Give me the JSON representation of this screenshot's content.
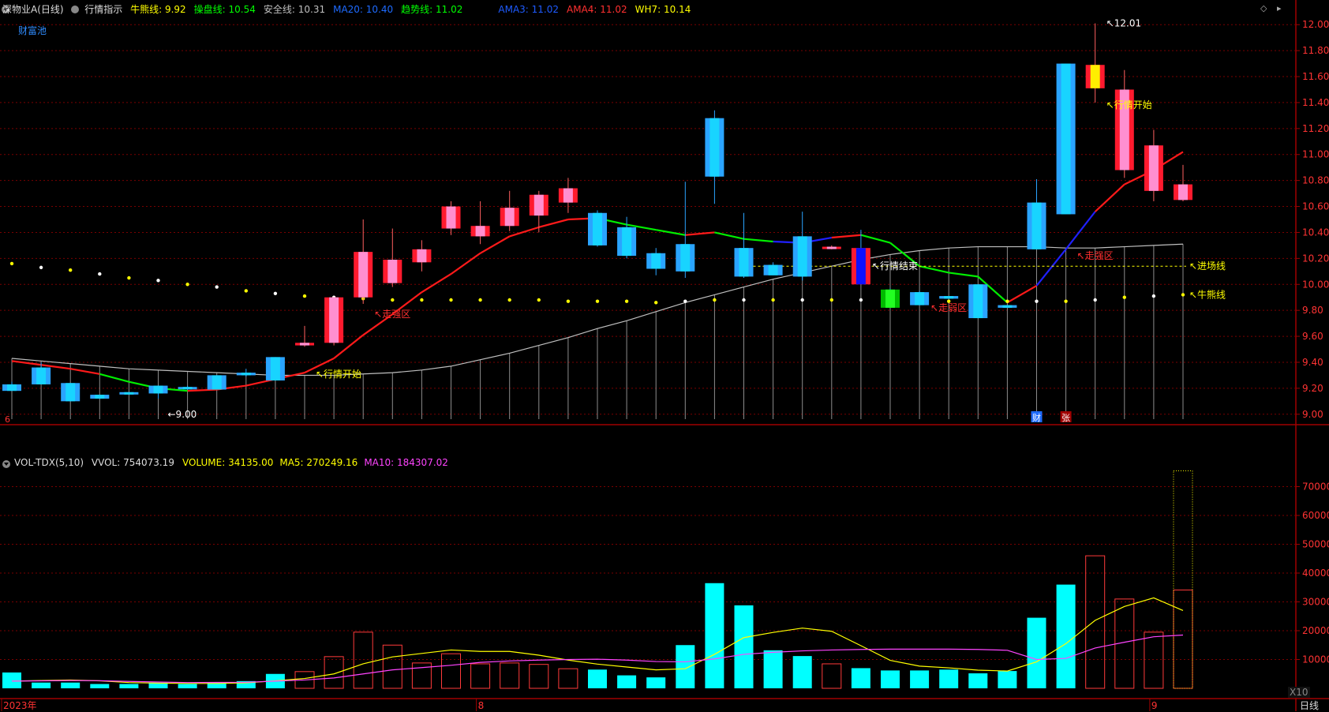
{
  "header": {
    "title": "深物业A(日线)",
    "indicator_name": "行情指示",
    "items": [
      {
        "label": "牛熊线:",
        "value": "9.92",
        "color": "#ffff00"
      },
      {
        "label": "操盘线:",
        "value": "10.54",
        "color": "#00ff00"
      },
      {
        "label": "安全线:",
        "value": "10.31",
        "color": "#bfbfbf"
      },
      {
        "label": "MA20:",
        "value": "10.40",
        "color": "#1e6bff"
      },
      {
        "label": "趋势线:",
        "value": "11.02",
        "color": "#00ff00"
      },
      {
        "label": "AMA3:",
        "value": "11.02",
        "color": "#1e5bff"
      },
      {
        "label": "AMA4:",
        "value": "11.02",
        "color": "#ff3030"
      },
      {
        "label": "WH7:",
        "value": "10.14",
        "color": "#ffff00"
      }
    ],
    "pool_label": "财富池"
  },
  "vol_header": {
    "name": "VOL-TDX(5,10)",
    "items": [
      {
        "label": "VVOL:",
        "value": "754073.19",
        "color": "#dddddd"
      },
      {
        "label": "VOLUME:",
        "value": "34135.00",
        "color": "#ffff00"
      },
      {
        "label": "MA5:",
        "value": "270249.16",
        "color": "#ffff00"
      },
      {
        "label": "MA10:",
        "value": "184307.02",
        "color": "#ff44ff"
      }
    ]
  },
  "footer": {
    "period_label": "日线",
    "scale_label": "X10",
    "date_labels": [
      {
        "index": 0,
        "text": "2023年"
      },
      {
        "index": 16,
        "text": "8"
      },
      {
        "index": 39,
        "text": "9"
      }
    ]
  },
  "colors": {
    "up": "#ff1a2e",
    "up_inner": "#ff8fd0",
    "down": "#2aa4ff",
    "down_inner": "#18d4ff",
    "grid": "#7a0000",
    "cyan": "#00ffff",
    "yellow": "#ffff00",
    "magenta": "#ff44ff"
  },
  "chart_data": [
    {
      "type": "candlestick",
      "title": "深物业A(日线)",
      "ylim": [
        8.95,
        12.05
      ],
      "yticks": [
        9.0,
        9.2,
        9.4,
        9.6,
        9.8,
        10.0,
        10.2,
        10.4,
        10.6,
        10.8,
        11.0,
        11.2,
        11.4,
        11.6,
        11.8,
        12.0
      ],
      "candles": [
        {
          "o": 9.23,
          "h": 9.25,
          "l": 9.18,
          "c": 9.18,
          "ma": 9.43,
          "trend": 9.41
        },
        {
          "o": 9.36,
          "h": 9.4,
          "l": 9.23,
          "c": 9.23,
          "ma": 9.41,
          "trend": 9.38
        },
        {
          "o": 9.24,
          "h": 9.24,
          "l": 9.1,
          "c": 9.1,
          "ma": 9.39,
          "trend": 9.35
        },
        {
          "o": 9.15,
          "h": 9.15,
          "l": 9.12,
          "c": 9.12,
          "ma": 9.37,
          "trend": 9.31
        },
        {
          "o": 9.17,
          "h": 9.17,
          "l": 9.15,
          "c": 9.16,
          "ma": 9.35,
          "trend": 9.25
        },
        {
          "o": 9.22,
          "h": 9.22,
          "l": 9.12,
          "c": 9.16,
          "ma": 9.34,
          "trend": 9.2
        },
        {
          "o": 9.21,
          "h": 9.22,
          "l": 9.19,
          "c": 9.2,
          "ma": 9.33,
          "trend": 9.18
        },
        {
          "o": 9.3,
          "h": 9.3,
          "l": 9.19,
          "c": 9.19,
          "ma": 9.32,
          "trend": 9.19
        },
        {
          "o": 9.32,
          "h": 9.35,
          "l": 9.29,
          "c": 9.3,
          "ma": 9.31,
          "trend": 9.22
        },
        {
          "o": 9.44,
          "h": 9.44,
          "l": 9.26,
          "c": 9.26,
          "ma": 9.3,
          "trend": 9.27
        },
        {
          "o": 9.53,
          "h": 9.68,
          "l": 9.52,
          "c": 9.55,
          "ma": 9.3,
          "trend": 9.32
        },
        {
          "o": 9.55,
          "h": 9.9,
          "l": 9.53,
          "c": 9.9,
          "ma": 9.3,
          "trend": 9.43
        },
        {
          "o": 9.9,
          "h": 10.5,
          "l": 9.85,
          "c": 10.25,
          "ma": 9.31,
          "trend": 9.61
        },
        {
          "o": 10.01,
          "h": 10.43,
          "l": 9.98,
          "c": 10.19,
          "ma": 9.32,
          "trend": 9.77
        },
        {
          "o": 10.17,
          "h": 10.34,
          "l": 10.1,
          "c": 10.27,
          "ma": 9.34,
          "trend": 9.94
        },
        {
          "o": 10.43,
          "h": 10.64,
          "l": 10.38,
          "c": 10.6,
          "ma": 9.37,
          "trend": 10.08
        },
        {
          "o": 10.37,
          "h": 10.64,
          "l": 10.31,
          "c": 10.45,
          "ma": 9.42,
          "trend": 10.24
        },
        {
          "o": 10.45,
          "h": 10.72,
          "l": 10.41,
          "c": 10.59,
          "ma": 9.47,
          "trend": 10.37
        },
        {
          "o": 10.53,
          "h": 10.72,
          "l": 10.4,
          "c": 10.69,
          "ma": 9.53,
          "trend": 10.44
        },
        {
          "o": 10.63,
          "h": 10.82,
          "l": 10.55,
          "c": 10.74,
          "ma": 9.59,
          "trend": 10.5
        },
        {
          "o": 10.55,
          "h": 10.57,
          "l": 10.29,
          "c": 10.3,
          "ma": 9.66,
          "trend": 10.51
        },
        {
          "o": 10.44,
          "h": 10.52,
          "l": 10.2,
          "c": 10.22,
          "ma": 9.72,
          "trend": 10.46
        },
        {
          "o": 10.24,
          "h": 10.28,
          "l": 10.07,
          "c": 10.12,
          "ma": 9.79,
          "trend": 10.42
        },
        {
          "o": 10.31,
          "h": 10.79,
          "l": 10.05,
          "c": 10.1,
          "ma": 9.86,
          "trend": 10.38
        },
        {
          "o": 11.28,
          "h": 11.34,
          "l": 10.62,
          "c": 10.83,
          "ma": 9.92,
          "trend": 10.4
        },
        {
          "o": 10.28,
          "h": 10.55,
          "l": 10.05,
          "c": 10.06,
          "ma": 9.98,
          "trend": 10.35
        },
        {
          "o": 10.15,
          "h": 10.17,
          "l": 10.07,
          "c": 10.07,
          "ma": 10.04,
          "trend": 10.33
        },
        {
          "o": 10.37,
          "h": 10.56,
          "l": 10.03,
          "c": 10.06,
          "ma": 10.09,
          "trend": 10.32
        },
        {
          "o": 10.28,
          "h": 10.3,
          "l": 10.27,
          "c": 10.29,
          "ma": 10.14,
          "trend": 10.36
        },
        {
          "o": 10.28,
          "h": 10.42,
          "l": 10.0,
          "c": 10.0,
          "ma": 10.19,
          "trend": 10.38
        },
        {
          "o": 9.96,
          "h": 9.97,
          "l": 9.83,
          "c": 9.82,
          "ma": 10.23,
          "trend": 10.32
        },
        {
          "o": 9.94,
          "h": 9.95,
          "l": 9.84,
          "c": 9.84,
          "ma": 10.26,
          "trend": 10.14
        },
        {
          "o": 9.91,
          "h": 9.91,
          "l": 9.89,
          "c": 9.89,
          "ma": 10.28,
          "trend": 10.09
        },
        {
          "o": 10.0,
          "h": 10.0,
          "l": 9.74,
          "c": 9.74,
          "ma": 10.29,
          "trend": 10.06
        },
        {
          "o": 9.84,
          "h": 9.84,
          "l": 9.82,
          "c": 9.82,
          "ma": 10.29,
          "trend": 9.86
        },
        {
          "o": 10.63,
          "h": 10.81,
          "l": 10.27,
          "c": 10.27,
          "ma": 10.29,
          "trend": 9.99
        },
        {
          "o": 11.7,
          "h": 11.7,
          "l": 10.54,
          "c": 10.54,
          "ma": 10.28,
          "trend": 10.27
        },
        {
          "o": 11.51,
          "h": 12.01,
          "l": 11.4,
          "c": 11.69,
          "ma": 10.28,
          "trend": 10.56
        },
        {
          "o": 10.88,
          "h": 11.65,
          "l": 10.82,
          "c": 11.5,
          "ma": 10.29,
          "trend": 10.77
        },
        {
          "o": 10.72,
          "h": 11.19,
          "l": 10.64,
          "c": 11.07,
          "ma": 10.3,
          "trend": 10.88
        },
        {
          "o": 10.65,
          "h": 10.92,
          "l": 10.64,
          "c": 10.77,
          "ma": 10.31,
          "trend": 11.02
        }
      ],
      "bull_bear_dots": [
        10.16,
        10.13,
        10.11,
        10.08,
        10.05,
        10.03,
        10.0,
        9.98,
        9.95,
        9.93,
        9.91,
        9.9,
        9.89,
        9.88,
        9.88,
        9.88,
        9.88,
        9.88,
        9.88,
        9.87,
        9.87,
        9.87,
        9.86,
        9.87,
        9.88,
        9.88,
        9.88,
        9.88,
        9.88,
        9.88,
        9.88,
        9.88,
        9.87,
        9.87,
        9.87,
        9.87,
        9.87,
        9.88,
        9.9,
        9.91,
        9.92
      ],
      "entry_line": {
        "value": 10.14,
        "label": "进场线"
      },
      "bull_bear_label": "牛熊线",
      "annotations": [
        {
          "index": 5,
          "price": 9.0,
          "text": "←9.00",
          "color": "#ffffff"
        },
        {
          "index": 37,
          "price": 12.01,
          "text": "12.01",
          "color": "#ffffff"
        },
        {
          "index": 10,
          "price": 9.31,
          "text": "行情开始",
          "color": "#ffff00"
        },
        {
          "index": 12,
          "price": 9.77,
          "text": "走强区",
          "color": "#ff3030"
        },
        {
          "index": 29,
          "price": 10.14,
          "text": "行情结束",
          "color": "#ffffff"
        },
        {
          "index": 31,
          "price": 9.82,
          "text": "走弱区",
          "color": "#ff3030"
        },
        {
          "index": 36,
          "price": 10.22,
          "text": "走强区",
          "color": "#ff3030"
        },
        {
          "index": 37,
          "price": 11.38,
          "text": "行情开始",
          "color": "#ffff00"
        }
      ],
      "markers": [
        {
          "index": 35,
          "text": "财",
          "bg": "#1e6bff",
          "fg": "#ffffff"
        },
        {
          "index": 36,
          "text": "张",
          "bg": "#a00000",
          "fg": "#ffffff"
        }
      ],
      "bottom_marker": "6"
    },
    {
      "type": "bar",
      "title": "VOL-TDX(5,10)",
      "ylim": [
        0,
        80000
      ],
      "yticks": [
        10000,
        20000,
        30000,
        40000,
        50000,
        60000,
        70000
      ],
      "volumes": [
        5500,
        2000,
        2000,
        1500,
        1500,
        2000,
        1500,
        2000,
        2500,
        5000,
        5800,
        11000,
        19500,
        15000,
        8800,
        12000,
        8500,
        8800,
        8300,
        6800,
        6500,
        4500,
        3800,
        15000,
        36500,
        28800,
        13200,
        11200,
        8500,
        7000,
        6200,
        6200,
        6500,
        5200,
        6000,
        24500,
        36000,
        46000,
        31000,
        19500,
        34135
      ],
      "ma5": [
        2500,
        2700,
        2900,
        2600,
        2000,
        1800,
        1700,
        1700,
        1900,
        2600,
        3400,
        5000,
        8500,
        10900,
        12100,
        13300,
        12800,
        12800,
        11500,
        9800,
        8400,
        7400,
        6400,
        6800,
        11800,
        17600,
        19400,
        20900,
        19800,
        14800,
        9700,
        7700,
        7100,
        6300,
        6000,
        9200,
        15500,
        23600,
        28400,
        31400,
        27000
      ],
      "ma10": [
        2500,
        2600,
        2700,
        2650,
        2400,
        2200,
        2000,
        2050,
        2100,
        2500,
        2900,
        3600,
        5000,
        6400,
        7200,
        8000,
        9000,
        9500,
        9800,
        10000,
        10100,
        9800,
        9300,
        9200,
        10200,
        11800,
        12500,
        13000,
        13300,
        13500,
        13600,
        13600,
        13600,
        13500,
        13200,
        10000,
        10400,
        14000,
        16000,
        17900,
        18500
      ],
      "last_bar_ghost": 75500
    }
  ]
}
